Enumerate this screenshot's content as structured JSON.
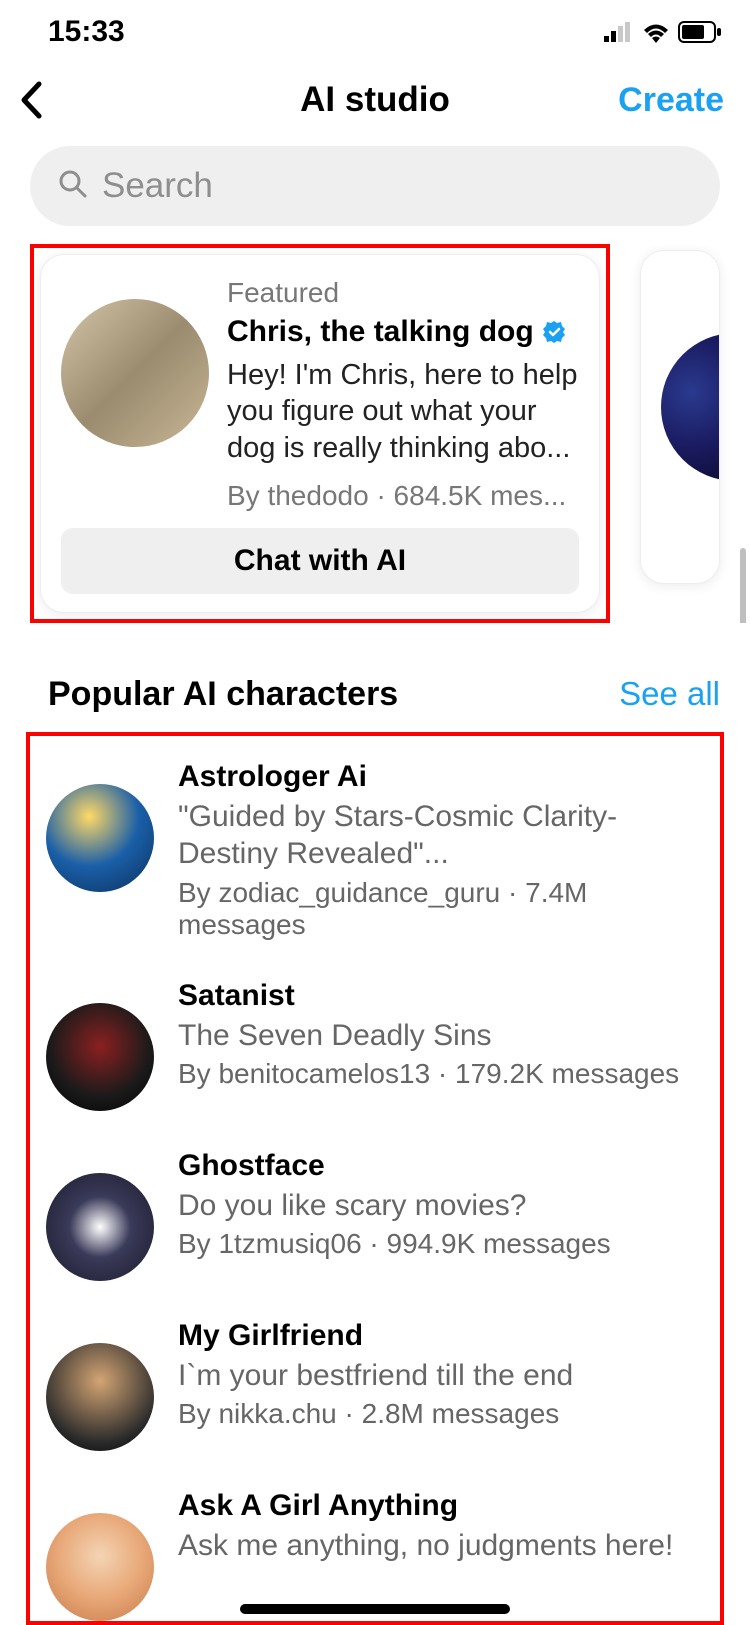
{
  "statusbar": {
    "time": "15:33"
  },
  "nav": {
    "title": "AI studio",
    "create": "Create"
  },
  "search": {
    "placeholder": "Search"
  },
  "featured": {
    "label": "Featured",
    "name": "Chris, the talking dog",
    "desc": "Hey! I'm Chris, here to help you figure out what your dog is really thinking abo...",
    "byline": "By thedodo · 684.5K mes...",
    "cta": "Chat with AI"
  },
  "section": {
    "title": "Popular AI characters",
    "see_all": "See all"
  },
  "chars": [
    {
      "name": "Astrologer Ai",
      "desc": "\"Guided by Stars-Cosmic Clarity-Destiny Revealed\"...",
      "byline": "By zodiac_guidance_guru · 7.4M messages"
    },
    {
      "name": "Satanist",
      "desc": "The Seven Deadly Sins",
      "byline": "By benitocamelos13 · 179.2K messages"
    },
    {
      "name": "Ghostface",
      "desc": "Do you like scary movies?",
      "byline": "By 1tzmusiq06 · 994.9K messages"
    },
    {
      "name": "My Girlfriend",
      "desc": "I`m your bestfriend till the end",
      "byline": "By nikka.chu · 2.8M messages"
    },
    {
      "name": "Ask A Girl Anything",
      "desc": "Ask me anything, no judgments here!",
      "byline": ""
    }
  ]
}
